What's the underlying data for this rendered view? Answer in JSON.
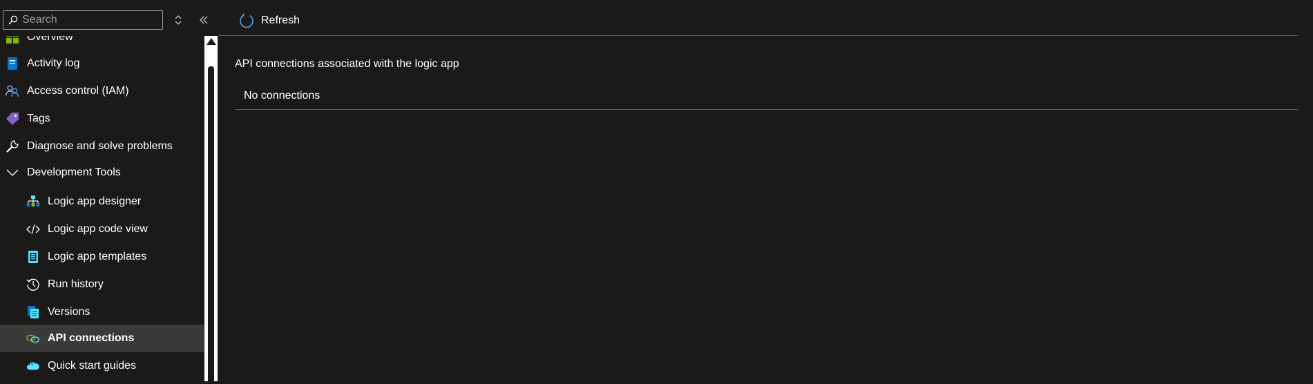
{
  "search": {
    "placeholder": "Search"
  },
  "sidebar": {
    "items": [
      {
        "label": "Overview",
        "icon": "overview-grid-icon"
      },
      {
        "label": "Activity log",
        "icon": "activity-log-icon"
      },
      {
        "label": "Access control (IAM)",
        "icon": "people-icon"
      },
      {
        "label": "Tags",
        "icon": "tag-icon"
      },
      {
        "label": "Diagnose and solve problems",
        "icon": "wrench-icon"
      },
      {
        "label": "Development Tools",
        "icon": "chevron-down-icon"
      },
      {
        "label": "Logic app designer",
        "icon": "designer-hierarchy-icon"
      },
      {
        "label": "Logic app code view",
        "icon": "code-icon"
      },
      {
        "label": "Logic app templates",
        "icon": "templates-icon"
      },
      {
        "label": "Run history",
        "icon": "history-icon"
      },
      {
        "label": "Versions",
        "icon": "versions-icon"
      },
      {
        "label": "API connections",
        "icon": "api-connection-icon",
        "selected": true
      },
      {
        "label": "Quick start guides",
        "icon": "cloud-icon"
      }
    ]
  },
  "toolbar": {
    "refresh_label": "Refresh"
  },
  "main": {
    "section_title": "API connections associated with the logic app",
    "empty_text": "No connections"
  },
  "colors": {
    "background": "#1b1a19",
    "selected": "#3b3a39",
    "accent_blue": "#0078d4",
    "green": "#7fba00"
  }
}
